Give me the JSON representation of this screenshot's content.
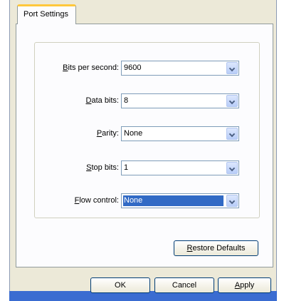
{
  "tab": {
    "label": "Port Settings"
  },
  "fields": [
    {
      "accel": "B",
      "rest": "its per second:",
      "value": "9600"
    },
    {
      "accel": "D",
      "rest": "ata bits:",
      "value": "8"
    },
    {
      "accel": "P",
      "rest": "arity:",
      "value": "None"
    },
    {
      "accel": "S",
      "rest": "top bits:",
      "value": "1"
    },
    {
      "accel": "F",
      "rest": "low control:",
      "value": "None"
    }
  ],
  "buttons": {
    "restore_accel": "R",
    "restore_rest": "estore Defaults",
    "ok": "OK",
    "cancel": "Cancel",
    "apply_accel": "A",
    "apply_rest": "pply"
  },
  "colors": {
    "selection": "#316ac5",
    "tab_highlight": "#ffc83c",
    "window_face": "#ece9d8"
  }
}
